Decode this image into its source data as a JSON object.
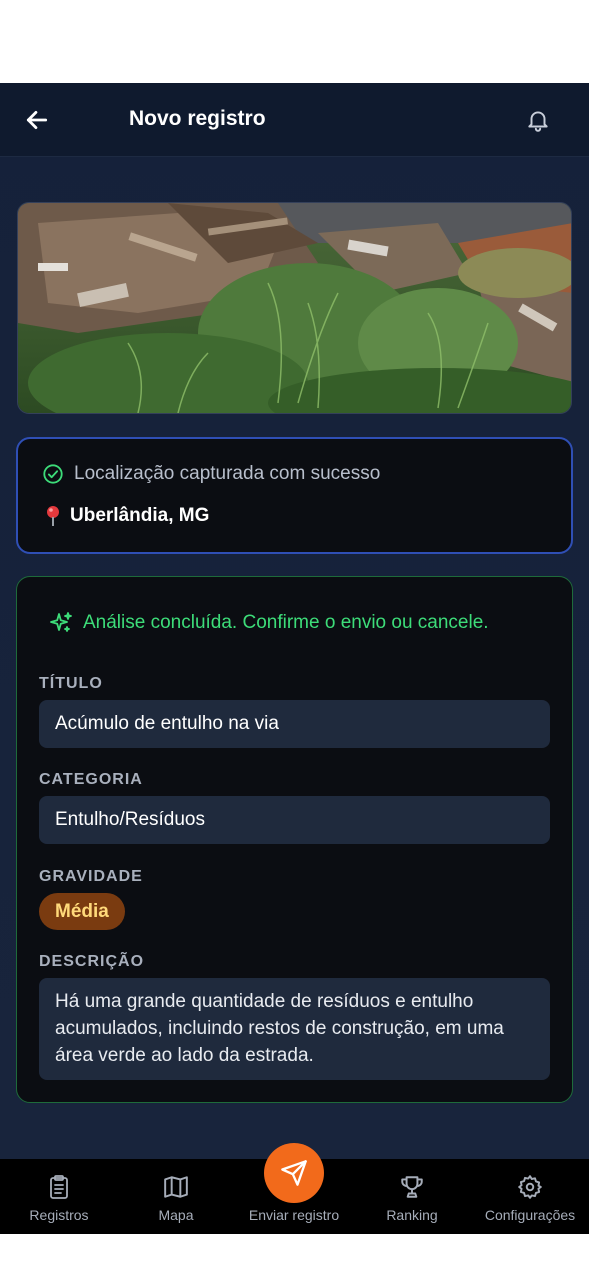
{
  "header": {
    "title": "Novo registro",
    "back_icon": "arrow-left-icon",
    "notification_icon": "bell-icon"
  },
  "photo": {
    "subject": "Entulho e resíduos de construção sobre vegetação"
  },
  "location": {
    "status_text": "Localização capturada com sucesso",
    "status_icon": "check-circle-icon",
    "status_color": "#3ddc79",
    "place": "Uberlândia, MG",
    "place_icon": "map-pin-icon"
  },
  "analysis": {
    "message": "Análise concluída. Confirme o envio ou cancele.",
    "message_icon": "sparkles-icon",
    "accent_color": "#3ddc79",
    "title_label": "TÍTULO",
    "title_value": "Acúmulo de entulho na via",
    "category_label": "CATEGORIA",
    "category_value": "Entulho/Resíduos",
    "severity_label": "GRAVIDADE",
    "severity_value": "Média",
    "description_label": "DESCRIÇÃO",
    "description_value": "Há uma grande quantidade de resíduos e entulho acumulados, incluindo restos de construção, em uma área verde ao lado da estrada."
  },
  "nav": {
    "items": [
      {
        "label": "Registros",
        "icon": "clipboard-icon"
      },
      {
        "label": "Mapa",
        "icon": "map-icon"
      },
      {
        "label": "Enviar registro",
        "icon": "send-icon"
      },
      {
        "label": "Ranking",
        "icon": "trophy-icon"
      },
      {
        "label": "Configurações",
        "icon": "gear-icon"
      }
    ],
    "fab_color": "#f26a1b"
  }
}
